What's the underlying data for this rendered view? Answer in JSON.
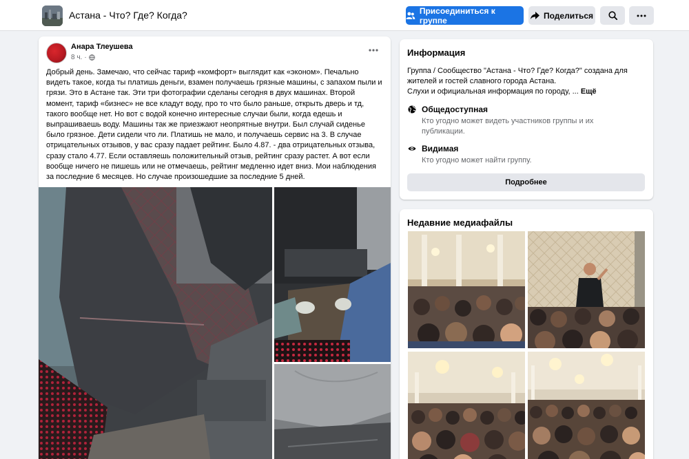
{
  "header": {
    "group_name": "Астана - Что? Где? Когда?",
    "join_label": "Присоединиться к группе",
    "share_label": "Поделиться",
    "accent_color": "#1b74e4"
  },
  "post": {
    "author": "Анара Тлеушева",
    "time": "8 ч.",
    "privacy_icon": "globe-icon",
    "text": "Добрый день. Замечаю, что сейчас тариф «комфорт» выглядит как «эконом». Печально видеть такое, когда ты платишь деньги, взамен получаешь грязные машины, с запахом пыли и грязи. Это в Астане так. Эти три фотографии сделаны сегодня в двух машинах. Второй момент, тариф «бизнес» не все кладут воду, про то что было раньше, открыть дверь и тд, такого вообще нет. Но вот с водой конечно интересные случаи были, когда едешь и выпрашиваешь воду. Машины так же приезжают неопрятные внутри. Был случай сиденье было грязное. Дети сидели что ли. Платишь не мало, и получаешь сервис на 3. В случае отрицательных отзывов, у вас сразу падает рейтинг. Было 4.87. - два отрицательных отзыва, сразу стало 4.77. Если оставляешь положительный отзыв, рейтинг сразу растет. А вот если вообще ничего не пишешь или не отмечаешь, рейтинг медленно идет вниз. Мои наблюдения за последние 6 месяцев. Но случае произошедшие за последние 5 дней."
  },
  "info": {
    "title": "Информация",
    "description": "Группа / Сообщество \"Астана - Что? Где? Когда?\" создана для жителей и гостей славного города Астана.",
    "description2": "Слухи и официальная информация по городу, ...",
    "more_label": "Ещё",
    "public_title": "Общедоступная",
    "public_sub": "Кто угодно может видеть участников группы и их публикации.",
    "visible_title": "Видимая",
    "visible_sub": "Кто угодно может найти группу.",
    "details_label": "Подробнее"
  },
  "media": {
    "title": "Недавние медиафайлы"
  }
}
